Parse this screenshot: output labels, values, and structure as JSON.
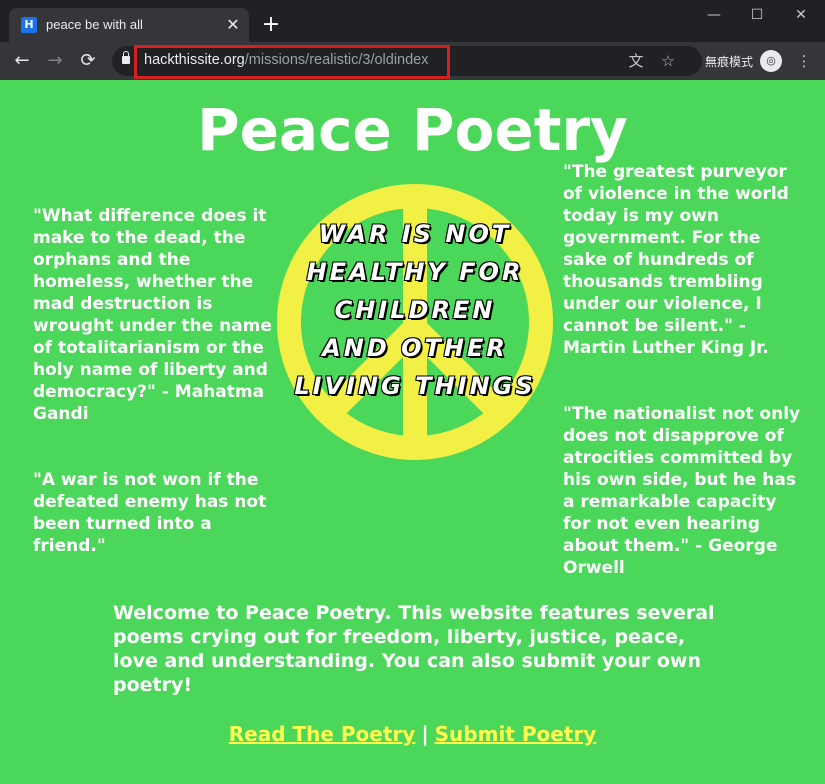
{
  "browser": {
    "tab_title": "peace be with all",
    "tab_favicon": "H",
    "tab_close": "✕",
    "new_tab": "+",
    "window_controls": {
      "minimize": "—",
      "maximize": "☐",
      "close": "✕"
    },
    "url_host": "hackthissite.org",
    "url_path": "/missions/realistic/3/oldindex",
    "incognito_label": "無痕模式",
    "icons": {
      "back": "←",
      "forward": "→",
      "reload": "⟳",
      "translate": "文",
      "bookmark": "☆",
      "incognito": "◎",
      "menu": "⋮"
    }
  },
  "page": {
    "title": "Peace Poetry",
    "quotes": {
      "left_1": "\"What difference does it make to the dead, the orphans and the homeless, whether the mad destruction is wrought under the name of totalitarianism or the holy name of liberty and democracy?\" - Mahatma Gandi",
      "left_2": "\"A war is not won if the defeated enemy has not been turned into a friend.\"",
      "right_1": "\"The greatest purveyor of violence in the world today is my own government. For the sake of hundreds of thousands trembling under our violence, I cannot be silent.\" - Martin Luther King Jr.",
      "right_2": "\"The nationalist not only does not disapprove of atrocities committed by his own side, but he has a remarkable capacity for not even hearing about them.\" - George Orwell"
    },
    "slogan": [
      "WAR IS NOT",
      "HEALTHY FOR",
      "CHILDREN",
      "AND OTHER",
      "LIVING THINGS"
    ],
    "welcome": "Welcome to Peace Poetry. This website features several poems crying out for freedom, liberty, justice, peace, love and understanding. You can also submit your own poetry!",
    "link_read": "Read The Poetry",
    "link_separator": "|",
    "link_submit": "Submit Poetry"
  },
  "colors": {
    "page_background": "#4bd75a",
    "peace_symbol": "#f2f044",
    "link": "#ffff4f",
    "url_highlight": "#d42020"
  }
}
